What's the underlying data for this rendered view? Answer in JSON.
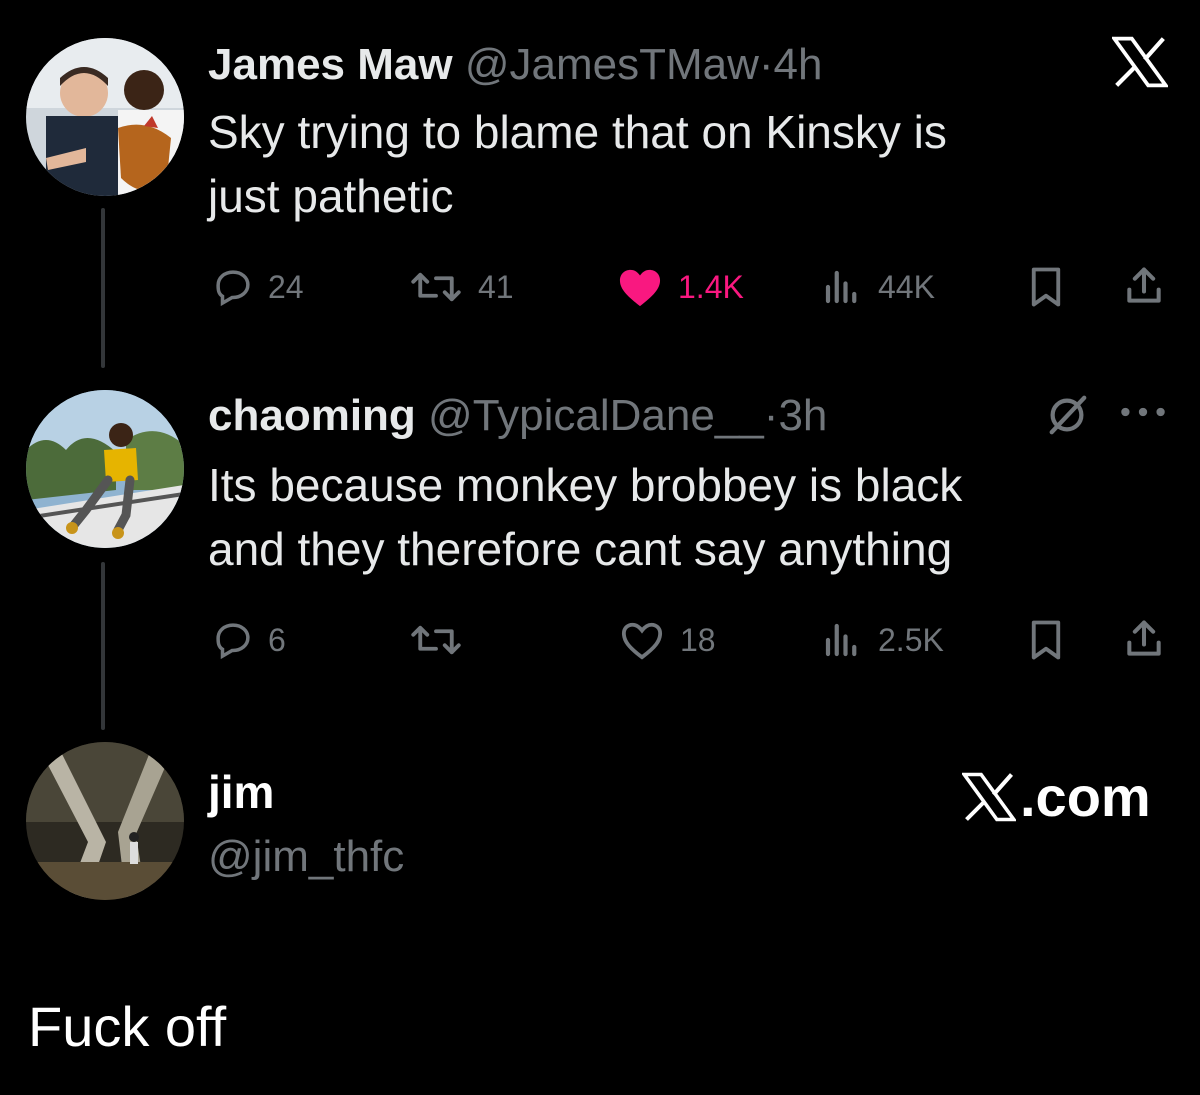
{
  "tweets": [
    {
      "name": "James Maw",
      "handle": "@JamesTMaw",
      "sep": "·",
      "time": "4h",
      "text_lines": [
        "Sky trying to blame that on Kinsky is",
        "just pathetic"
      ],
      "replies": "24",
      "retweets": "41",
      "likes": "1.4K",
      "views": "44K",
      "liked": true
    },
    {
      "name": "chaoming",
      "handle": "@TypicalDane__",
      "sep": "·",
      "time": "3h",
      "text_lines": [
        "Its because monkey brobbey is black",
        "and they therefore cant say anything"
      ],
      "replies": "6",
      "retweets": "",
      "likes": "18",
      "views": "2.5K",
      "liked": false
    }
  ],
  "quote_card": {
    "name": "jim",
    "handle": "@jim_thfc",
    "brand": ".com"
  },
  "reply_text": "Fuck off",
  "colors": {
    "background": "#000000",
    "text": "#e7e9ea",
    "muted": "#71767b",
    "like": "#f91880"
  },
  "icons": [
    "x-logo-icon",
    "reply-icon",
    "retweet-icon",
    "heart-icon",
    "views-icon",
    "bookmark-icon",
    "share-icon",
    "grok-icon",
    "more-icon"
  ]
}
